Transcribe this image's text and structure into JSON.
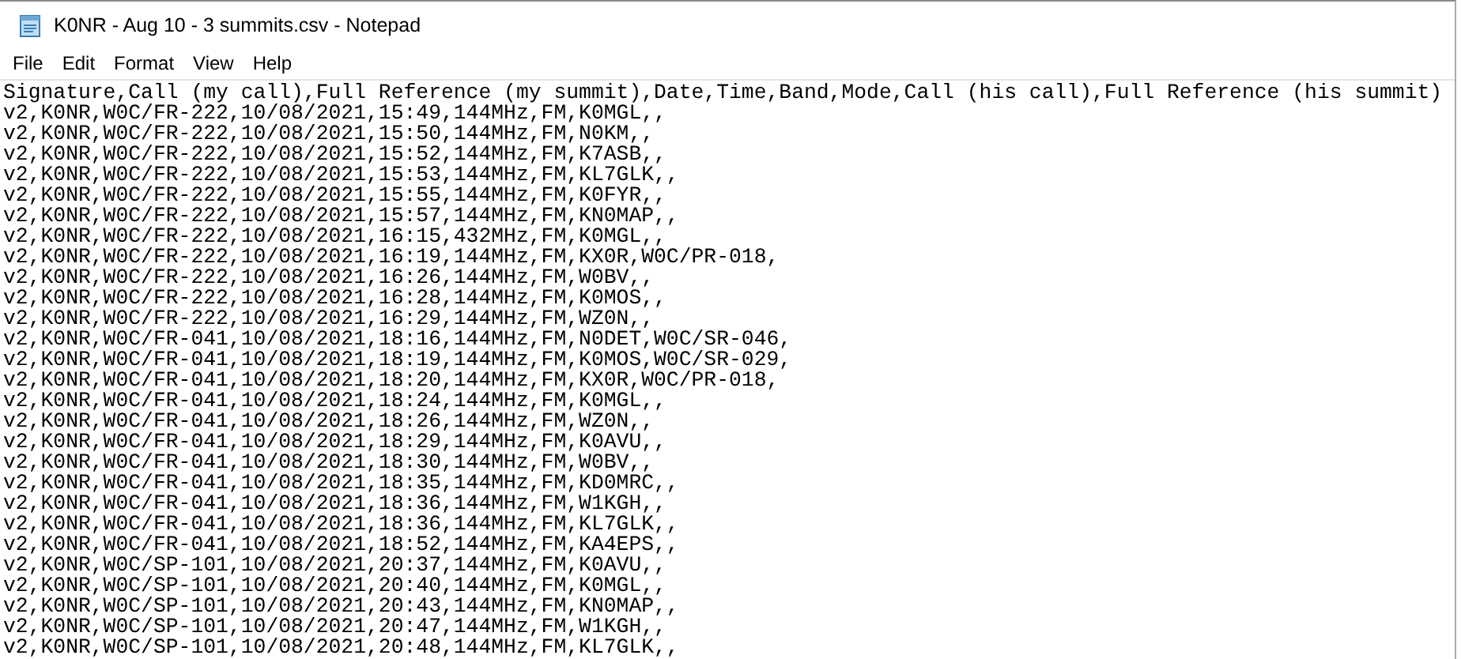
{
  "window": {
    "title": "K0NR - Aug 10 - 3 summits.csv - Notepad"
  },
  "menu": [
    "File",
    "Edit",
    "Format",
    "View",
    "Help"
  ],
  "lines": [
    "Signature,Call (my call),Full Reference (my summit),Date,Time,Band,Mode,Call (his call),Full Reference (his summit)",
    "v2,K0NR,W0C/FR-222,10/08/2021,15:49,144MHz,FM,K0MGL,,",
    "v2,K0NR,W0C/FR-222,10/08/2021,15:50,144MHz,FM,N0KM,,",
    "v2,K0NR,W0C/FR-222,10/08/2021,15:52,144MHz,FM,K7ASB,,",
    "v2,K0NR,W0C/FR-222,10/08/2021,15:53,144MHz,FM,KL7GLK,,",
    "v2,K0NR,W0C/FR-222,10/08/2021,15:55,144MHz,FM,K0FYR,,",
    "v2,K0NR,W0C/FR-222,10/08/2021,15:57,144MHz,FM,KN0MAP,,",
    "v2,K0NR,W0C/FR-222,10/08/2021,16:15,432MHz,FM,K0MGL,,",
    "v2,K0NR,W0C/FR-222,10/08/2021,16:19,144MHz,FM,KX0R,W0C/PR-018,",
    "v2,K0NR,W0C/FR-222,10/08/2021,16:26,144MHz,FM,W0BV,,",
    "v2,K0NR,W0C/FR-222,10/08/2021,16:28,144MHz,FM,K0MOS,,",
    "v2,K0NR,W0C/FR-222,10/08/2021,16:29,144MHz,FM,WZ0N,,",
    "v2,K0NR,W0C/FR-041,10/08/2021,18:16,144MHz,FM,N0DET,W0C/SR-046,",
    "v2,K0NR,W0C/FR-041,10/08/2021,18:19,144MHz,FM,K0MOS,W0C/SR-029,",
    "v2,K0NR,W0C/FR-041,10/08/2021,18:20,144MHz,FM,KX0R,W0C/PR-018,",
    "v2,K0NR,W0C/FR-041,10/08/2021,18:24,144MHz,FM,K0MGL,,",
    "v2,K0NR,W0C/FR-041,10/08/2021,18:26,144MHz,FM,WZ0N,,",
    "v2,K0NR,W0C/FR-041,10/08/2021,18:29,144MHz,FM,K0AVU,,",
    "v2,K0NR,W0C/FR-041,10/08/2021,18:30,144MHz,FM,W0BV,,",
    "v2,K0NR,W0C/FR-041,10/08/2021,18:35,144MHz,FM,KD0MRC,,",
    "v2,K0NR,W0C/FR-041,10/08/2021,18:36,144MHz,FM,W1KGH,,",
    "v2,K0NR,W0C/FR-041,10/08/2021,18:36,144MHz,FM,KL7GLK,,",
    "v2,K0NR,W0C/FR-041,10/08/2021,18:52,144MHz,FM,KA4EPS,,",
    "v2,K0NR,W0C/SP-101,10/08/2021,20:37,144MHz,FM,K0AVU,,",
    "v2,K0NR,W0C/SP-101,10/08/2021,20:40,144MHz,FM,K0MGL,,",
    "v2,K0NR,W0C/SP-101,10/08/2021,20:43,144MHz,FM,KN0MAP,,",
    "v2,K0NR,W0C/SP-101,10/08/2021,20:47,144MHz,FM,W1KGH,,",
    "v2,K0NR,W0C/SP-101,10/08/2021,20:48,144MHz,FM,KL7GLK,,"
  ]
}
